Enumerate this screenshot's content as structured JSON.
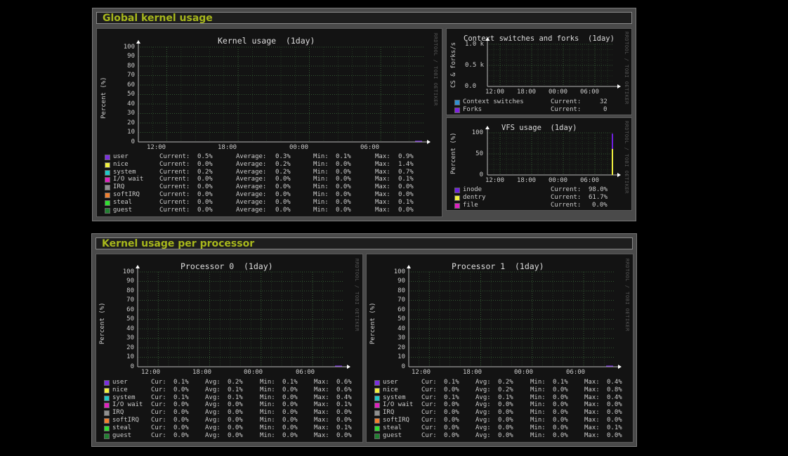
{
  "sections": {
    "global": "Global kernel usage",
    "per_cpu": "Kernel usage per processor"
  },
  "watermark": "RRDTOOL / TOBI OETIKER",
  "colors": {
    "user": "#7b2fe0",
    "nice": "#f0f040",
    "system": "#20c8c8",
    "iowait": "#e020c0",
    "irq": "#909090",
    "softirq": "#f08030",
    "steal": "#30e030",
    "guest": "#208030",
    "cs": "#3090d0",
    "forks": "#8020e0",
    "inode": "#7020e0",
    "dentry": "#f0f040",
    "file": "#e020c0"
  },
  "kernel": {
    "title": "Kernel usage  (1day)",
    "ylabel": "Percent (%)",
    "yticks": [
      "100",
      "90",
      "80",
      "70",
      "60",
      "50",
      "40",
      "30",
      "20",
      "10",
      "0"
    ],
    "xticks": [
      "12:00",
      "18:00",
      "00:00",
      "06:00"
    ],
    "col_labels": {
      "cur": "Current:",
      "avg": "Average:",
      "min": "Min:",
      "max": "Max:"
    },
    "legend": [
      {
        "name": "user",
        "cur": "0.5%",
        "avg": "0.3%",
        "min": "0.1%",
        "max": "0.9%"
      },
      {
        "name": "nice",
        "cur": "0.0%",
        "avg": "0.2%",
        "min": "0.0%",
        "max": "1.4%"
      },
      {
        "name": "system",
        "cur": "0.2%",
        "avg": "0.2%",
        "min": "0.0%",
        "max": "0.7%"
      },
      {
        "name": "I/O wait",
        "cur": "0.0%",
        "avg": "0.0%",
        "min": "0.0%",
        "max": "0.1%"
      },
      {
        "name": "IRQ",
        "cur": "0.0%",
        "avg": "0.0%",
        "min": "0.0%",
        "max": "0.0%"
      },
      {
        "name": "softIRQ",
        "cur": "0.0%",
        "avg": "0.0%",
        "min": "0.0%",
        "max": "0.0%"
      },
      {
        "name": "steal",
        "cur": "0.0%",
        "avg": "0.0%",
        "min": "0.0%",
        "max": "0.1%"
      },
      {
        "name": "guest",
        "cur": "0.0%",
        "avg": "0.0%",
        "min": "0.0%",
        "max": "0.0%"
      }
    ]
  },
  "cs": {
    "title": "Context switches and forks  (1day)",
    "ylabel": "CS & forks/s",
    "yticks": [
      "1.0 k",
      "0.5 k",
      "0.0"
    ],
    "xticks": [
      "12:00",
      "18:00",
      "00:00",
      "06:00"
    ],
    "cur_label": "Current:",
    "legend": [
      {
        "name": "Context switches",
        "cur": "32"
      },
      {
        "name": "Forks",
        "cur": "0"
      }
    ]
  },
  "vfs": {
    "title": "VFS usage  (1day)",
    "ylabel": "Percent (%)",
    "yticks": [
      "100",
      "50",
      "0"
    ],
    "xticks": [
      "12:00",
      "18:00",
      "00:00",
      "06:00"
    ],
    "cur_label": "Current:",
    "legend": [
      {
        "name": "inode",
        "cur": "98.0%"
      },
      {
        "name": "dentry",
        "cur": "61.7%"
      },
      {
        "name": "file",
        "cur": "0.0%"
      }
    ]
  },
  "cpu0": {
    "title": "Processor 0  (1day)",
    "ylabel": "Percent (%)",
    "yticks": [
      "100",
      "90",
      "80",
      "70",
      "60",
      "50",
      "40",
      "30",
      "20",
      "10",
      "0"
    ],
    "xticks": [
      "12:00",
      "18:00",
      "00:00",
      "06:00"
    ],
    "col_labels": {
      "cur": "Cur:",
      "avg": "Avg:",
      "min": "Min:",
      "max": "Max:"
    },
    "legend": [
      {
        "name": "user",
        "cur": "0.1%",
        "avg": "0.2%",
        "min": "0.1%",
        "max": "0.6%"
      },
      {
        "name": "nice",
        "cur": "0.0%",
        "avg": "0.1%",
        "min": "0.0%",
        "max": "0.6%"
      },
      {
        "name": "system",
        "cur": "0.1%",
        "avg": "0.1%",
        "min": "0.0%",
        "max": "0.4%"
      },
      {
        "name": "I/O wait",
        "cur": "0.0%",
        "avg": "0.0%",
        "min": "0.0%",
        "max": "0.1%"
      },
      {
        "name": "IRQ",
        "cur": "0.0%",
        "avg": "0.0%",
        "min": "0.0%",
        "max": "0.0%"
      },
      {
        "name": "softIRQ",
        "cur": "0.0%",
        "avg": "0.0%",
        "min": "0.0%",
        "max": "0.0%"
      },
      {
        "name": "steal",
        "cur": "0.0%",
        "avg": "0.0%",
        "min": "0.0%",
        "max": "0.1%"
      },
      {
        "name": "guest",
        "cur": "0.0%",
        "avg": "0.0%",
        "min": "0.0%",
        "max": "0.0%"
      }
    ]
  },
  "cpu1": {
    "title": "Processor 1  (1day)",
    "ylabel": "Percent (%)",
    "yticks": [
      "100",
      "90",
      "80",
      "70",
      "60",
      "50",
      "40",
      "30",
      "20",
      "10",
      "0"
    ],
    "xticks": [
      "12:00",
      "18:00",
      "00:00",
      "06:00"
    ],
    "col_labels": {
      "cur": "Cur:",
      "avg": "Avg:",
      "min": "Min:",
      "max": "Max:"
    },
    "legend": [
      {
        "name": "user",
        "cur": "0.1%",
        "avg": "0.2%",
        "min": "0.1%",
        "max": "0.4%"
      },
      {
        "name": "nice",
        "cur": "0.0%",
        "avg": "0.2%",
        "min": "0.0%",
        "max": "0.8%"
      },
      {
        "name": "system",
        "cur": "0.1%",
        "avg": "0.1%",
        "min": "0.0%",
        "max": "0.4%"
      },
      {
        "name": "I/O wait",
        "cur": "0.0%",
        "avg": "0.0%",
        "min": "0.0%",
        "max": "0.0%"
      },
      {
        "name": "IRQ",
        "cur": "0.0%",
        "avg": "0.0%",
        "min": "0.0%",
        "max": "0.0%"
      },
      {
        "name": "softIRQ",
        "cur": "0.0%",
        "avg": "0.0%",
        "min": "0.0%",
        "max": "0.0%"
      },
      {
        "name": "steal",
        "cur": "0.0%",
        "avg": "0.0%",
        "min": "0.0%",
        "max": "0.1%"
      },
      {
        "name": "guest",
        "cur": "0.0%",
        "avg": "0.0%",
        "min": "0.0%",
        "max": "0.0%"
      }
    ]
  }
}
